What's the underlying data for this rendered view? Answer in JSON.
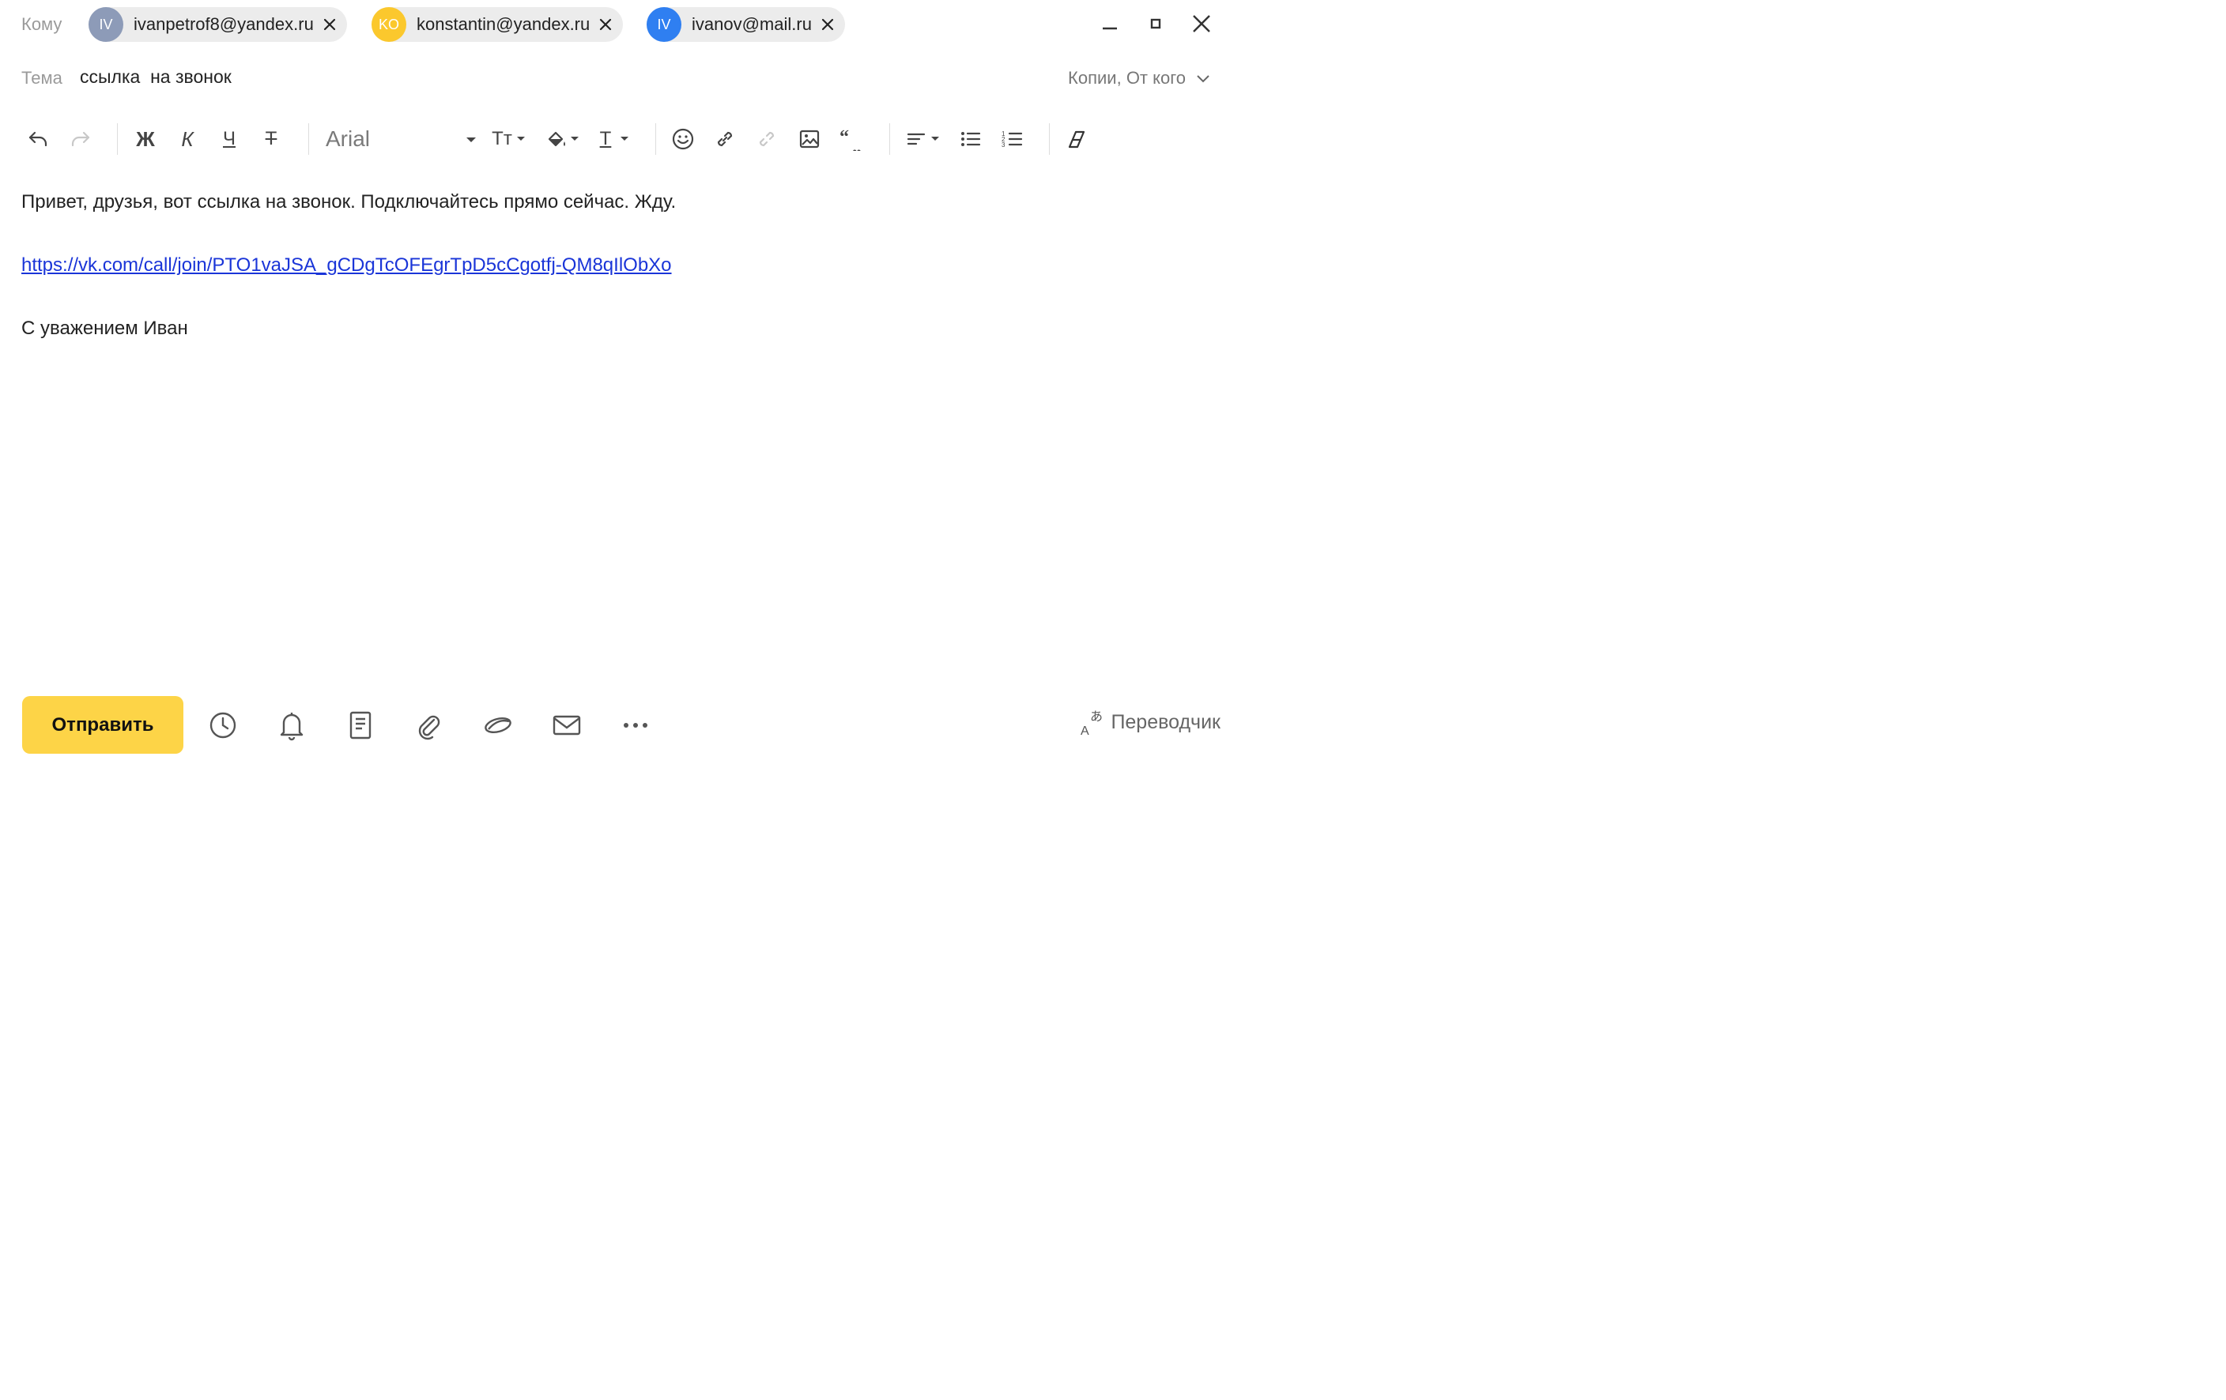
{
  "to": {
    "label": "Кому",
    "recipients": [
      {
        "initials": "IV",
        "email": "ivanpetrof8@yandex.ru",
        "avatar_color": "#8d9bb8"
      },
      {
        "initials": "KO",
        "email": "konstantin@yandex.ru",
        "avatar_color": "#fbc82d"
      },
      {
        "initials": "IV",
        "email": "ivanov@mail.ru",
        "avatar_color": "#2f7ff1"
      }
    ]
  },
  "window_controls": [
    "minimize-icon",
    "maximize-icon",
    "close-icon"
  ],
  "subject": {
    "label": "Тема",
    "value": "ссылка  на звонок",
    "copies_label": "Копии, От кого"
  },
  "toolbar": {
    "icons": [
      "undo-icon",
      "redo-icon",
      "bold-icon",
      "italic-icon",
      "underline-icon",
      "strikethrough-icon",
      "font-size-icon",
      "fill-color-icon",
      "text-color-icon",
      "emoji-icon",
      "link-icon",
      "unlink-icon",
      "image-icon",
      "quote-icon",
      "align-icon",
      "bullet-list-icon",
      "numbered-list-icon",
      "clear-format-icon"
    ],
    "font_name": "Arial",
    "bold_glyph": "Ж",
    "italic_glyph": "К",
    "underline_glyph": "Ч",
    "strike_glyph": "Т",
    "size_glyph": "Тт",
    "text_color_glyph": "Т"
  },
  "body": {
    "greeting": "Привет, друзья, вот ссылка на звонок. Подключайтесь прямо сейчас. Жду.",
    "link": "https://vk.com/call/join/PTO1vaJSA_gCDgTcOFEgrTpD5cCgotfj-QM8qIlObXo",
    "signature": "С уважением Иван"
  },
  "footer": {
    "send_label": "Отправить",
    "icons": [
      "clock-icon",
      "bell-icon",
      "template-icon",
      "paperclip-icon",
      "disk-icon",
      "envelope-icon",
      "more-icon"
    ],
    "translator_label": "Переводчик"
  },
  "colors": {
    "send_button": "#fdd447",
    "link": "#1a35d8",
    "chip_background": "#ececec"
  }
}
